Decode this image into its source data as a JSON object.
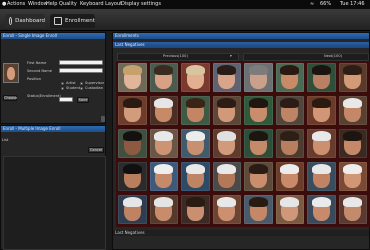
{
  "menubar": {
    "apple": "",
    "items": [
      "Actions",
      "Window",
      "Help",
      "Quality",
      "Keyboard Layout",
      "Display settings"
    ],
    "status": [
      " ",
      "66%",
      "Tue 17:46"
    ]
  },
  "tabs": [
    {
      "label": "Dashboard"
    },
    {
      "label": "Enrollment"
    }
  ],
  "left": {
    "top_header": "Enroll - Single Image Enroll",
    "first_name_label": "First Name",
    "second_name_label": "Second Name",
    "position_label": "Position",
    "radio_options": [
      "Artist",
      "Supervisor",
      "Student",
      "Custodian"
    ],
    "status_label": "Status(Enrollment)",
    "save_label": "Save",
    "photo_label": "Choose",
    "bottom_header": "Enroll - Multiple Image Enroll",
    "list_label": "List",
    "cancel_label": "Cancel"
  },
  "right": {
    "top_header": "Enrollments",
    "sub_header": "Last Negatives",
    "previous_label": "Previous(100)",
    "next_label": "Next(100)",
    "bottom_header": "Last Negatives"
  },
  "grid": {
    "tiles": [
      {
        "bg": "#6f6a58",
        "skin": "#e0b59a",
        "hair": "#c7a16b"
      },
      {
        "bg": "#4a5b4f",
        "skin": "#d9a184",
        "hair": "#3b2a20"
      },
      {
        "bg": "#7a3a30",
        "skin": "#e2b091",
        "hair": "#d8c5a0"
      },
      {
        "bg": "#5d6370",
        "skin": "#d8a48a",
        "hair": "#2a1c16"
      },
      {
        "bg": "#6b7072",
        "skin": "#caa08a",
        "hair": "#7c7c7c"
      },
      {
        "bg": "#4a6a55",
        "skin": "#c98a68",
        "hair": "#2a1a12"
      },
      {
        "bg": "#2f4f3a",
        "skin": "#b98063",
        "hair": "#1c1410"
      },
      {
        "bg": "#5a3a2a",
        "skin": "#d39a78",
        "hair": "#2d1d15"
      },
      {
        "bg": "#6e3c2b",
        "skin": "#d29c7c",
        "hair": "#2a1b12"
      },
      {
        "bg": "#4b2f25",
        "skin": "#c78a66",
        "hair": "#e6e6e6"
      },
      {
        "bg": "#3d5a45",
        "skin": "#c48565",
        "hair": "#3a2317"
      },
      {
        "bg": "#5c4638",
        "skin": "#d09a7a",
        "hair": "#2c1c14"
      },
      {
        "bg": "#315a3c",
        "skin": "#c98c6c",
        "hair": "#1f1610"
      },
      {
        "bg": "#52463c",
        "skin": "#bd8566",
        "hair": "#2b1d15"
      },
      {
        "bg": "#6b3a28",
        "skin": "#d19676",
        "hair": "#2b1a10"
      },
      {
        "bg": "#5a4030",
        "skin": "#c48868",
        "hair": "#e8e8e8"
      },
      {
        "bg": "#3f5040",
        "skin": "#8c5a40",
        "hair": "#151010"
      },
      {
        "bg": "#6a5646",
        "skin": "#cd9474",
        "hair": "#e8e8e8"
      },
      {
        "bg": "#405c6c",
        "skin": "#c88f70",
        "hair": "#ececec"
      },
      {
        "bg": "#5e3b2c",
        "skin": "#d19a7a",
        "hair": "#e0e0e0"
      },
      {
        "bg": "#2e4e3a",
        "skin": "#c58a6a",
        "hair": "#1d1510"
      },
      {
        "bg": "#4c3c30",
        "skin": "#b77f60",
        "hair": "#2d1f15"
      },
      {
        "bg": "#683c2c",
        "skin": "#cc9070",
        "hair": "#e8e8e8"
      },
      {
        "bg": "#3a2a22",
        "skin": "#c58868",
        "hair": "#1e1510"
      },
      {
        "bg": "#2b2b2b",
        "skin": "#b87e5e",
        "hair": "#101010"
      },
      {
        "bg": "#3d5a7a",
        "skin": "#c48a6a",
        "hair": "#eeeeee"
      },
      {
        "bg": "#2d4a66",
        "skin": "#bf8464",
        "hair": "#e8e8e8"
      },
      {
        "bg": "#4a4a4a",
        "skin": "#b27858",
        "hair": "#e8e8e8"
      },
      {
        "bg": "#5e4a3a",
        "skin": "#c98e6e",
        "hair": "#2a1c14"
      },
      {
        "bg": "#6a3c2a",
        "skin": "#c88a68",
        "hair": "#ececec"
      },
      {
        "bg": "#3a4d5c",
        "skin": "#c08464",
        "hair": "#e8e8e8"
      },
      {
        "bg": "#7a4a36",
        "skin": "#d09676",
        "hair": "#ededed"
      },
      {
        "bg": "#2c3e50",
        "skin": "#bf8363",
        "hair": "#e6e6e6"
      },
      {
        "bg": "#553a2c",
        "skin": "#c88c6c",
        "hair": "#e4e4e4"
      },
      {
        "bg": "#3b2b24",
        "skin": "#ca8f70",
        "hair": "#2a1b12"
      },
      {
        "bg": "#6b4434",
        "skin": "#cc9070",
        "hair": "#e8e8e8"
      },
      {
        "bg": "#4a5a6a",
        "skin": "#c48868",
        "hair": "#2a1b12"
      },
      {
        "bg": "#7a5a40",
        "skin": "#d0987a",
        "hair": "#e6e6e6"
      },
      {
        "bg": "#3a4a5a",
        "skin": "#c78b6b",
        "hair": "#eaeaea"
      },
      {
        "bg": "#5a3a30",
        "skin": "#c48a6c",
        "hair": "#e8e8e8"
      }
    ]
  }
}
